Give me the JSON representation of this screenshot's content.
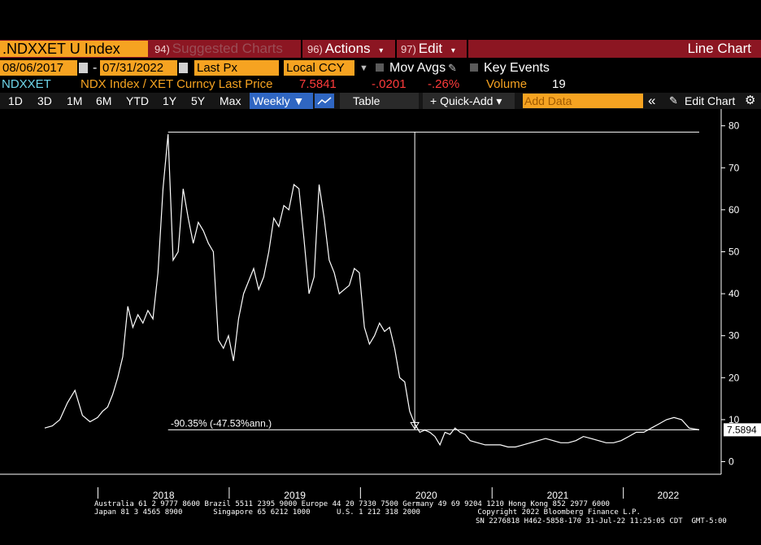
{
  "header": {
    "ticker": ".NDXXET U Index",
    "suggested_num": "94)",
    "suggested_label": "Suggested Charts",
    "actions_num": "96)",
    "actions_label": "Actions",
    "edit_num": "97)",
    "edit_label": "Edit",
    "chart_type": "Line Chart"
  },
  "controls": {
    "start_date": "08/06/2017",
    "date_sep": "-",
    "end_date": "07/31/2022",
    "field": "Last Px",
    "currency": "Local CCY",
    "mov_avgs": "Mov Avgs",
    "key_events": "Key Events"
  },
  "legend": {
    "short": "NDXXET",
    "desc": "NDX Index / XET Curncy Last Price",
    "last": "7.5841",
    "change": "-.0201",
    "pct": "-.26%",
    "volume_label": "Volume",
    "volume": "19"
  },
  "toolbar": {
    "periods": [
      "1D",
      "3D",
      "1M",
      "6M",
      "YTD",
      "1Y",
      "5Y",
      "Max"
    ],
    "frequency": "Weekly ▼",
    "table": "Table",
    "quick_add": "+ Quick-Add ▾",
    "add_data_placeholder": "Add Data",
    "collapse": "«",
    "edit_chart": "Edit Chart",
    "settings_icon": "gear-icon"
  },
  "colors": {
    "orange": "#f6a321",
    "title_red": "#8c1622",
    "blue": "#2f66c2",
    "legend_cyan": "#6fd6ea",
    "legend_orange": "#f6a321",
    "legend_red": "#ff3b3b"
  },
  "chart_data": {
    "type": "line",
    "series": [
      {
        "name": "NDXXET",
        "x": [
          "2017-08-06",
          "2017-08-27",
          "2017-09-17",
          "2017-10-08",
          "2017-10-29",
          "2017-11-19",
          "2017-12-10",
          "2017-12-31",
          "2018-01-14",
          "2018-01-28",
          "2018-02-11",
          "2018-02-25",
          "2018-03-11",
          "2018-03-25",
          "2018-04-08",
          "2018-04-22",
          "2018-05-06",
          "2018-05-20",
          "2018-06-03",
          "2018-06-17",
          "2018-07-01",
          "2018-07-15",
          "2018-07-29",
          "2018-08-12",
          "2018-08-26",
          "2018-09-09",
          "2018-09-23",
          "2018-10-07",
          "2018-10-21",
          "2018-11-04",
          "2018-11-18",
          "2018-12-02",
          "2018-12-16",
          "2018-12-30",
          "2019-01-13",
          "2019-01-27",
          "2019-02-10",
          "2019-02-24",
          "2019-03-10",
          "2019-03-24",
          "2019-04-07",
          "2019-04-21",
          "2019-05-05",
          "2019-05-19",
          "2019-06-02",
          "2019-06-16",
          "2019-06-30",
          "2019-07-14",
          "2019-07-28",
          "2019-08-11",
          "2019-08-25",
          "2019-09-08",
          "2019-09-22",
          "2019-10-06",
          "2019-10-20",
          "2019-11-03",
          "2019-11-17",
          "2019-12-01",
          "2019-12-15",
          "2019-12-29",
          "2020-01-12",
          "2020-01-26",
          "2020-02-09",
          "2020-02-23",
          "2020-03-08",
          "2020-03-22",
          "2020-04-05",
          "2020-04-19",
          "2020-05-03",
          "2020-05-17",
          "2020-05-31",
          "2020-06-14",
          "2020-06-28",
          "2020-07-12",
          "2020-07-26",
          "2020-08-09",
          "2020-08-23",
          "2020-09-06",
          "2020-09-20",
          "2020-10-04",
          "2020-10-18",
          "2020-11-01",
          "2020-11-22",
          "2020-12-13",
          "2021-01-03",
          "2021-01-24",
          "2021-02-14",
          "2021-03-07",
          "2021-03-28",
          "2021-04-18",
          "2021-05-09",
          "2021-05-30",
          "2021-06-20",
          "2021-07-11",
          "2021-08-01",
          "2021-08-22",
          "2021-09-12",
          "2021-10-03",
          "2021-10-24",
          "2021-11-14",
          "2021-12-05",
          "2021-12-26",
          "2022-01-16",
          "2022-02-06",
          "2022-02-27",
          "2022-03-20",
          "2022-04-10",
          "2022-05-01",
          "2022-05-22",
          "2022-06-12",
          "2022-07-03",
          "2022-07-31"
        ],
        "y": [
          8,
          8.5,
          10,
          14,
          17,
          11,
          9.5,
          10.5,
          12,
          13,
          16,
          20,
          25,
          37,
          32,
          35,
          33,
          36,
          34,
          45,
          65,
          78,
          48,
          50,
          65,
          58,
          52,
          57,
          55,
          52,
          50,
          29,
          27,
          30,
          24,
          34,
          40,
          43,
          46,
          41,
          44,
          50,
          58,
          56,
          61,
          60,
          66,
          65,
          53,
          40,
          44,
          66,
          58,
          48,
          45,
          40,
          41,
          42,
          46,
          45,
          32,
          28,
          30,
          33,
          31,
          32,
          27,
          20,
          19,
          12,
          9,
          7,
          7.5,
          7,
          6,
          4,
          7,
          6.5,
          8,
          7,
          6.5,
          5,
          4.5,
          4,
          4,
          4,
          3.5,
          3.5,
          4,
          4.5,
          5,
          5.5,
          5,
          4.5,
          4.5,
          5,
          6,
          5.5,
          5,
          4.5,
          4.5,
          5,
          6,
          7,
          7,
          8,
          9,
          10,
          10.5,
          10,
          8,
          7.5841
        ]
      }
    ],
    "y_ticks": [
      0,
      10,
      20,
      30,
      40,
      50,
      60,
      70,
      80
    ],
    "x_ticks": [
      "2018",
      "2019",
      "2020",
      "2021",
      "2022"
    ],
    "ylim": [
      -3,
      84
    ],
    "last_value_label": "7.5894",
    "annotation": "-90.35% (-47.53%ann.)",
    "peak": 78.5,
    "trough_date": "2020-05-31",
    "end_value": 7.5841,
    "grid": false
  },
  "footer": {
    "line1": "Australia 61 2 9777 8600 Brazil 5511 2395 9000 Europe 44 20 7330 7500 Germany 49 69 9204 1210 Hong Kong 852 2977 6000",
    "line2": "Japan 81 3 4565 8900       Singapore 65 6212 1000      U.S. 1 212 318 2000             Copyright 2022 Bloomberg Finance L.P.",
    "line3": "SN 2276818 H462-5858-170 31-Jul-22 11:25:05 CDT  GMT-5:00"
  }
}
